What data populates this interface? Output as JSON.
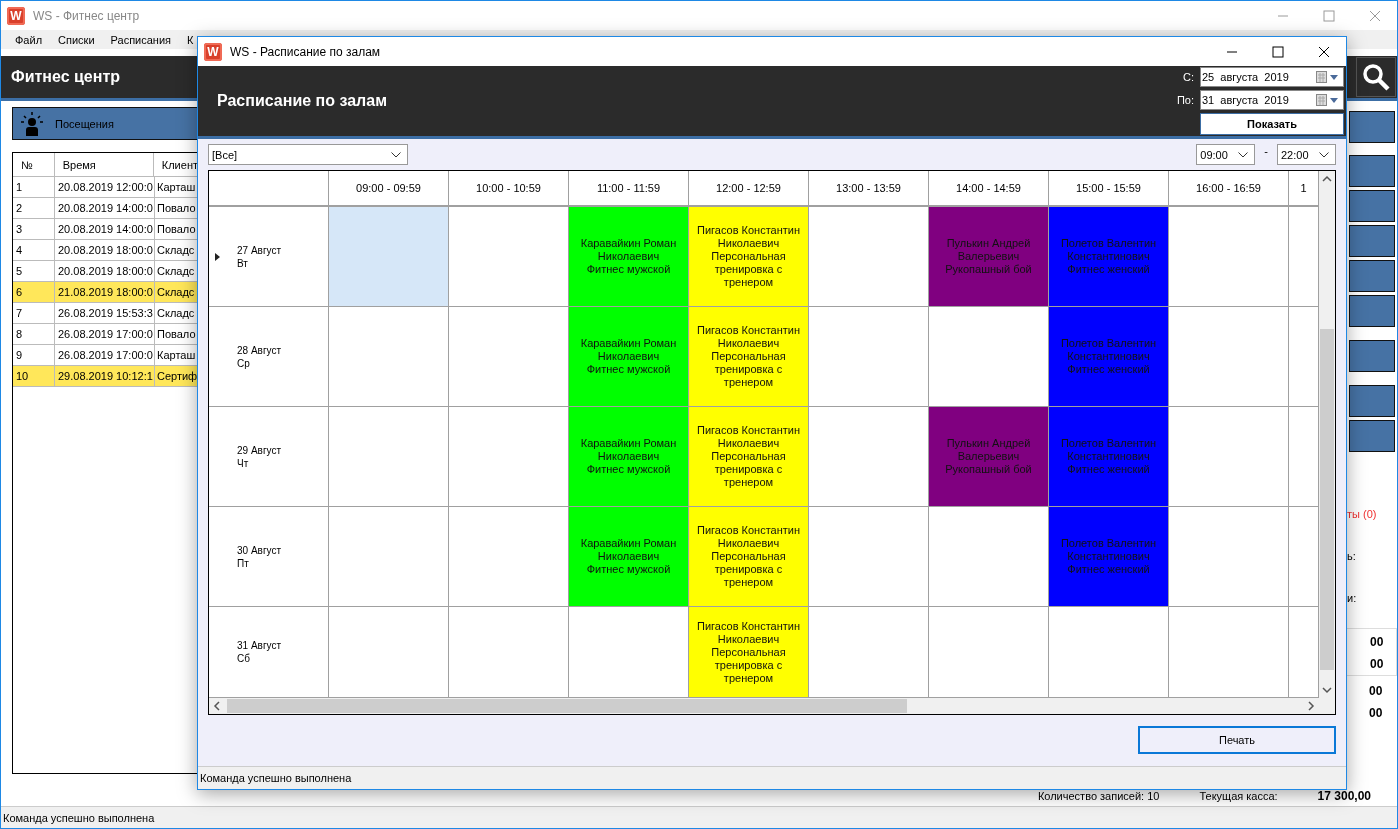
{
  "main_window": {
    "logo": "W",
    "title": "WS - Фитнес центр",
    "menu": [
      "Файл",
      "Списки",
      "Расписания",
      "К"
    ],
    "header_title": "Фитнес центр",
    "visits_button": "Посещения",
    "table": {
      "columns": [
        "№",
        "Время",
        "Клиент"
      ],
      "rows": [
        {
          "cells": [
            "1",
            "20.08.2019 12:00:0",
            "Карташ"
          ],
          "highlighted": false
        },
        {
          "cells": [
            "2",
            "20.08.2019 14:00:0",
            "Повало"
          ],
          "highlighted": false
        },
        {
          "cells": [
            "3",
            "20.08.2019 14:00:0",
            "Повало"
          ],
          "highlighted": false
        },
        {
          "cells": [
            "4",
            "20.08.2019 18:00:0",
            "Складс"
          ],
          "highlighted": false
        },
        {
          "cells": [
            "5",
            "20.08.2019 18:00:0",
            "Складс"
          ],
          "highlighted": false
        },
        {
          "cells": [
            "6",
            "21.08.2019 18:00:0",
            "Складс"
          ],
          "highlighted": true
        },
        {
          "cells": [
            "7",
            "26.08.2019 15:53:3",
            "Складс"
          ],
          "highlighted": false
        },
        {
          "cells": [
            "8",
            "26.08.2019 17:00:0",
            "Повало"
          ],
          "highlighted": false
        },
        {
          "cells": [
            "9",
            "26.08.2019 17:00:0",
            "Карташ"
          ],
          "highlighted": false
        },
        {
          "cells": [
            "10",
            "29.08.2019 10:12:1",
            "Сертиф"
          ],
          "highlighted": true
        }
      ]
    },
    "side_texts": [
      {
        "text": "ты (0)",
        "kind": "alert"
      },
      {
        "text": "ь:",
        "kind": "label"
      },
      {
        "text": "и:",
        "kind": "label"
      }
    ],
    "side_values": [
      "00",
      "00",
      "00",
      "00"
    ],
    "summary": {
      "records": "Количество записей: 10",
      "cash_label": "Текущая касса:",
      "cash_value": "17 300,00"
    },
    "status": "Команда успешно выполнена"
  },
  "dialog": {
    "logo": "W",
    "title": "WS - Расписание по залам",
    "header_title": "Расписание по залам",
    "from_label": "С:",
    "from_date": "25  августа  2019",
    "to_label": "По:",
    "to_date": "31  августа  2019",
    "show_button": "Показать",
    "hall_select": "[Все]",
    "time_from": "09:00",
    "time_separator": "-",
    "time_to": "22:00",
    "columns": [
      "09:00 - 09:59",
      "10:00 - 10:59",
      "11:00 - 11:59",
      "12:00 - 12:59",
      "13:00 - 13:59",
      "14:00 - 14:59",
      "15:00 - 15:59",
      "16:00 - 16:59",
      "1"
    ],
    "days": [
      {
        "date": "27 Август",
        "weekday": "Вт",
        "current": true,
        "cells": [
          {
            "selected": true
          },
          {
            "selected": false
          },
          {
            "selected": false,
            "color": "#00ff00",
            "lines": [
              "Каравайкин Роман",
              "Николаевич",
              "Фитнес мужской"
            ]
          },
          {
            "selected": false,
            "color": "#ffff00",
            "lines": [
              "Пигасов Константин",
              "Николаевич",
              "Персональная",
              "тренировка с",
              "тренером"
            ]
          },
          {
            "selected": false
          },
          {
            "selected": false,
            "color": "#800080",
            "lines": [
              "Пулькин Андрей",
              "Валерьевич",
              "Рукопашный бой"
            ]
          },
          {
            "selected": false,
            "color": "#0000ff",
            "lines": [
              "Полетов Валентин",
              "Константинович",
              "Фитнес женский"
            ]
          },
          {
            "selected": false
          },
          {
            "selected": false
          }
        ]
      },
      {
        "date": "28 Август",
        "weekday": "Ср",
        "current": false,
        "cells": [
          {
            "selected": false
          },
          {
            "selected": false
          },
          {
            "selected": false,
            "color": "#00ff00",
            "lines": [
              "Каравайкин Роман",
              "Николаевич",
              "Фитнес мужской"
            ]
          },
          {
            "selected": false,
            "color": "#ffff00",
            "lines": [
              "Пигасов Константин",
              "Николаевич",
              "Персональная",
              "тренировка с",
              "тренером"
            ]
          },
          {
            "selected": false
          },
          {
            "selected": false
          },
          {
            "selected": false,
            "color": "#0000ff",
            "lines": [
              "Полетов Валентин",
              "Константинович",
              "Фитнес женский"
            ]
          },
          {
            "selected": false
          },
          {
            "selected": false
          }
        ]
      },
      {
        "date": "29 Август",
        "weekday": "Чт",
        "current": false,
        "cells": [
          {
            "selected": false
          },
          {
            "selected": false
          },
          {
            "selected": false,
            "color": "#00ff00",
            "lines": [
              "Каравайкин Роман",
              "Николаевич",
              "Фитнес мужской"
            ]
          },
          {
            "selected": false,
            "color": "#ffff00",
            "lines": [
              "Пигасов Константин",
              "Николаевич",
              "Персональная",
              "тренировка с",
              "тренером"
            ]
          },
          {
            "selected": false
          },
          {
            "selected": false,
            "color": "#800080",
            "lines": [
              "Пулькин Андрей",
              "Валерьевич",
              "Рукопашный бой"
            ]
          },
          {
            "selected": false,
            "color": "#0000ff",
            "lines": [
              "Полетов Валентин",
              "Константинович",
              "Фитнес женский"
            ]
          },
          {
            "selected": false
          },
          {
            "selected": false
          }
        ]
      },
      {
        "date": "30 Август",
        "weekday": "Пт",
        "current": false,
        "cells": [
          {
            "selected": false
          },
          {
            "selected": false
          },
          {
            "selected": false,
            "color": "#00ff00",
            "lines": [
              "Каравайкин Роман",
              "Николаевич",
              "Фитнес мужской"
            ]
          },
          {
            "selected": false,
            "color": "#ffff00",
            "lines": [
              "Пигасов Константин",
              "Николаевич",
              "Персональная",
              "тренировка с",
              "тренером"
            ]
          },
          {
            "selected": false
          },
          {
            "selected": false
          },
          {
            "selected": false,
            "color": "#0000ff",
            "lines": [
              "Полетов Валентин",
              "Константинович",
              "Фитнес женский"
            ]
          },
          {
            "selected": false
          },
          {
            "selected": false
          }
        ]
      },
      {
        "date": "31 Август",
        "weekday": "Сб",
        "current": false,
        "cells": [
          {
            "selected": false
          },
          {
            "selected": false
          },
          {
            "selected": false
          },
          {
            "selected": false,
            "color": "#ffff00",
            "lines": [
              "Пигасов Константин",
              "Николаевич",
              "Персональная",
              "тренировка с",
              "тренером"
            ]
          },
          {
            "selected": false
          },
          {
            "selected": false
          },
          {
            "selected": false
          },
          {
            "selected": false
          },
          {
            "selected": false
          }
        ]
      }
    ],
    "print_button": "Печать",
    "status": "Команда успешно выполнена"
  }
}
